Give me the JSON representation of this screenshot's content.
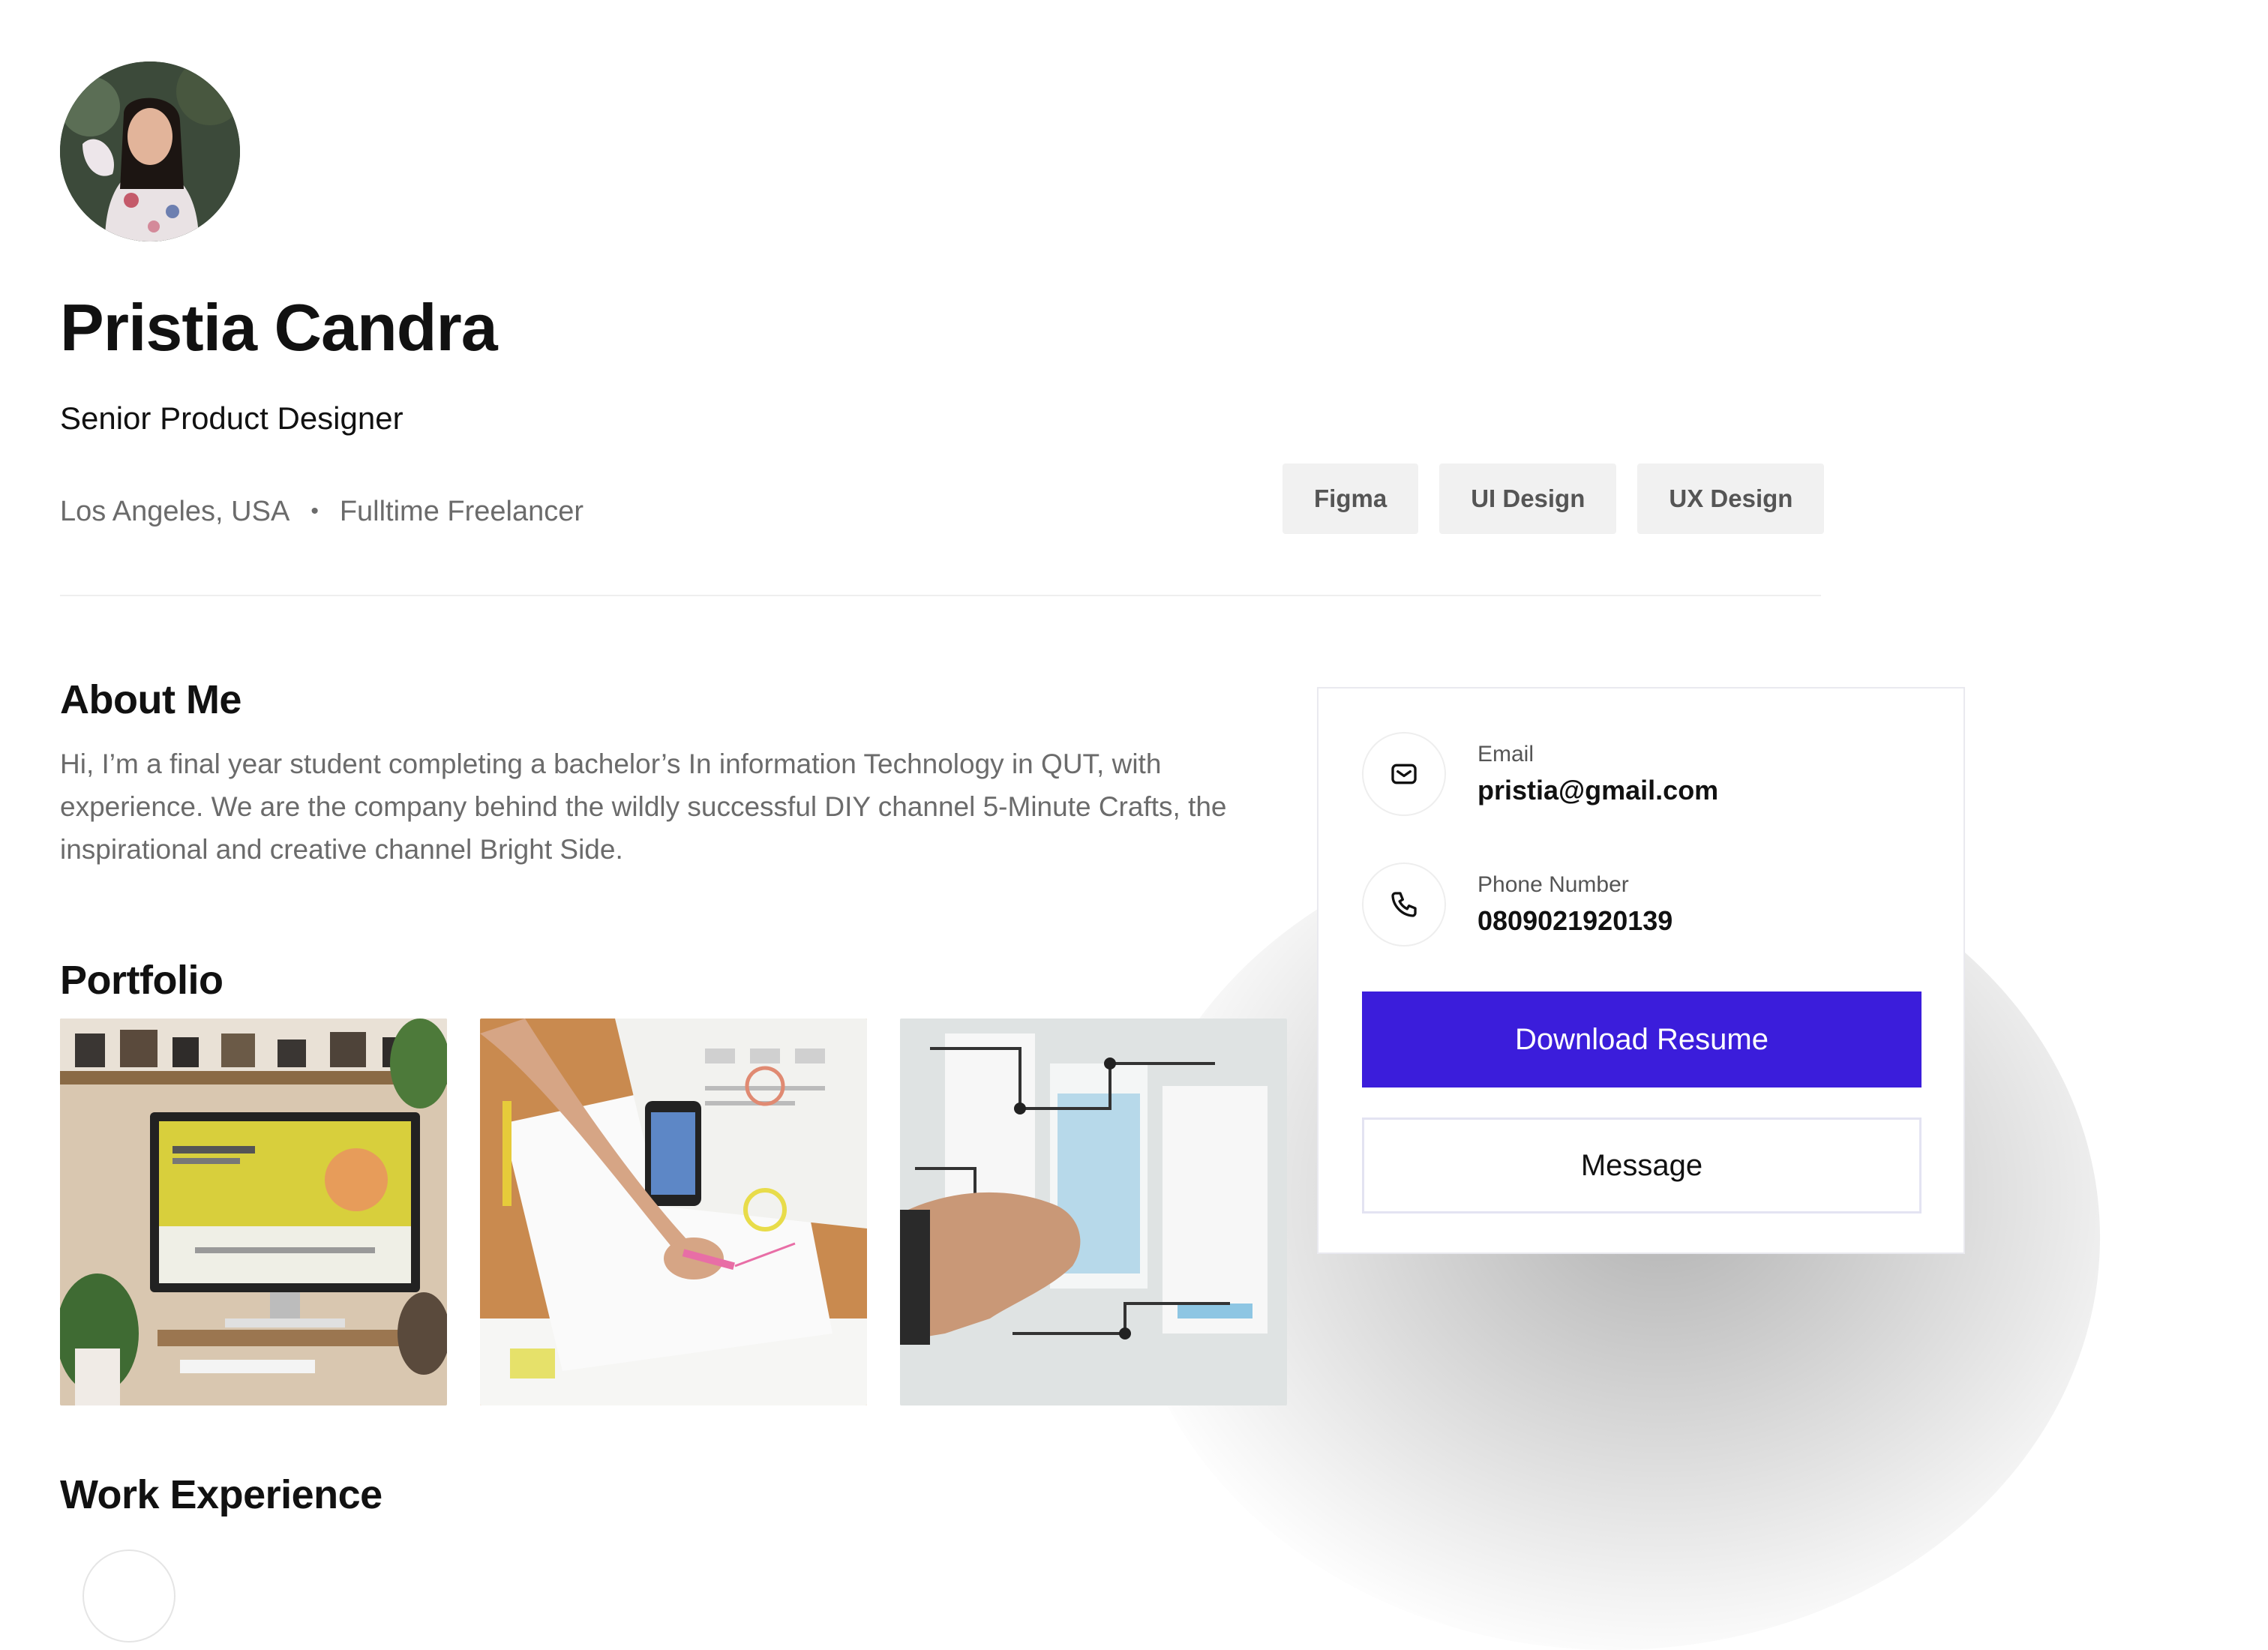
{
  "profile": {
    "name": "Pristia Candra",
    "role": "Senior Product Designer",
    "location": "Los Angeles, USA",
    "separator": "•",
    "employment": "Fulltime Freelancer",
    "skills": [
      "Figma",
      "UI Design",
      "UX Design"
    ]
  },
  "about": {
    "title": "About Me",
    "text": "Hi, I’m a final year student completing a bachelor’s In information Technology in QUT, with experience. We are the company behind the wildly successful DIY channel 5-Minute Crafts, the inspirational and creative channel Bright Side."
  },
  "portfolio": {
    "title": "Portfolio"
  },
  "work": {
    "title": "Work Experience"
  },
  "contact": {
    "email_label": "Email",
    "email_value": "pristia@gmail.com",
    "phone_label": "Phone Number",
    "phone_value": "0809021920139",
    "download_label": "Download Resume",
    "message_label": "Message"
  },
  "colors": {
    "accent": "#3b1ddb",
    "chip_bg": "#f1f1f1",
    "muted_text": "#6b6b6b"
  },
  "icons": {
    "email": "mail-icon",
    "phone": "phone-icon"
  }
}
